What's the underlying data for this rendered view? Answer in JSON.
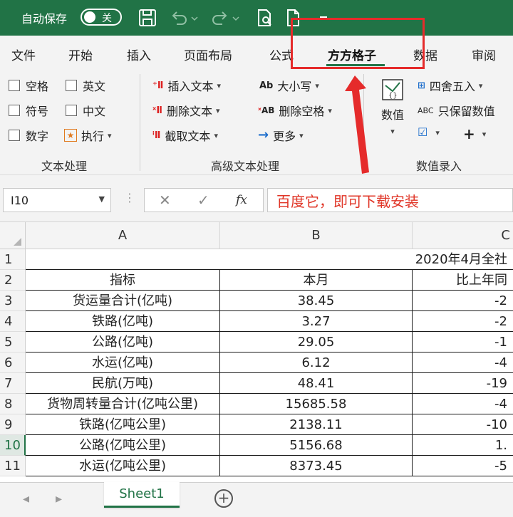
{
  "titlebar": {
    "autosave_label": "自动保存",
    "autosave_state": "关"
  },
  "tabs": [
    "文件",
    "开始",
    "插入",
    "页面布局",
    "公式",
    "方方格子",
    "数据",
    "审阅"
  ],
  "active_tab": "方方格子",
  "ribbon": {
    "text_processing": {
      "checkboxes": [
        "空格",
        "英文",
        "符号",
        "中文",
        "数字"
      ],
      "execute": "执行",
      "group_label": "文本处理"
    },
    "advanced_text": {
      "insert_text": "插入文本",
      "delete_text": "删除文本",
      "extract_text": "截取文本",
      "case": "大小写",
      "delete_spaces": "删除空格",
      "more": "更多",
      "group_label": "高级文本处理"
    },
    "numeric": {
      "value_button": "数值",
      "round": "四舍五入",
      "keep_value": "只保留数值",
      "group_label": "数值录入"
    }
  },
  "formula_bar": {
    "name_box": "I10",
    "fx": "fx",
    "content": "百度它，即可下载安装"
  },
  "columns": [
    "A",
    "B",
    "C"
  ],
  "rows": [
    {
      "num": "1",
      "a": "",
      "b": "",
      "c": "2020年4月全社"
    },
    {
      "num": "2",
      "a": "指标",
      "b": "本月",
      "c": "比上年同"
    },
    {
      "num": "3",
      "a": "货运量合计(亿吨)",
      "b": "38.45",
      "c": "-2"
    },
    {
      "num": "4",
      "a": "铁路(亿吨)",
      "b": "3.27",
      "c": "-2"
    },
    {
      "num": "5",
      "a": "公路(亿吨)",
      "b": "29.05",
      "c": "-1"
    },
    {
      "num": "6",
      "a": "水运(亿吨)",
      "b": "6.12",
      "c": "-4"
    },
    {
      "num": "7",
      "a": "民航(万吨)",
      "b": "48.41",
      "c": "-19"
    },
    {
      "num": "8",
      "a": "货物周转量合计(亿吨公里)",
      "b": "15685.58",
      "c": "-4"
    },
    {
      "num": "9",
      "a": "铁路(亿吨公里)",
      "b": "2138.11",
      "c": "-10"
    },
    {
      "num": "10",
      "a": "公路(亿吨公里)",
      "b": "5156.68",
      "c": "1."
    },
    {
      "num": "11",
      "a": "水运(亿吨公里)",
      "b": "8373.45",
      "c": "-5"
    }
  ],
  "selected_row": "10",
  "sheets": [
    "Sheet1"
  ],
  "colors": {
    "accent": "#217346",
    "highlight": "#e52b2b",
    "formula_text": "#e03426"
  }
}
